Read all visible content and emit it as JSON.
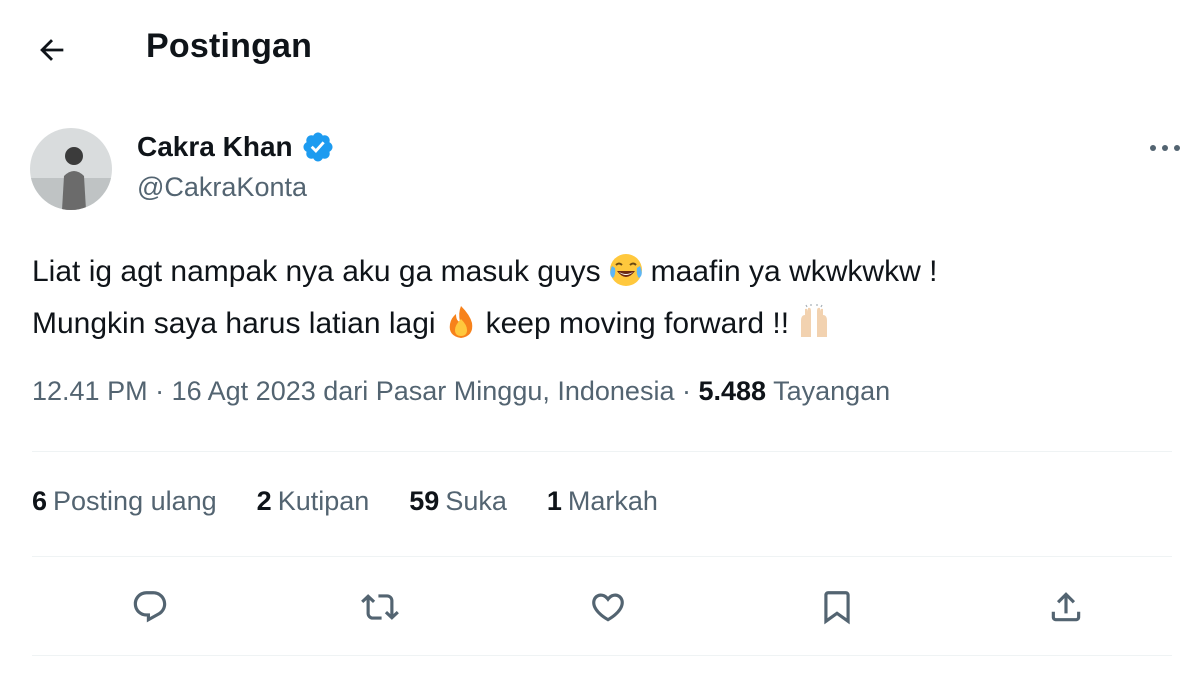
{
  "header": {
    "title": "Postingan",
    "back_icon": "arrow-left-icon"
  },
  "author": {
    "display_name": "Cakra Khan",
    "handle": "@CakraKonta",
    "verified_color": "#1d9bf0",
    "avatar_icon": "profile-photo"
  },
  "tweet": {
    "line1_part1": "Liat ig agt nampak nya aku ga masuk guys",
    "line1_part2": "maafin ya  wkwkwkw !",
    "line2_part1": "Mungkin saya harus latian lagi",
    "line2_part2": "keep moving forward !!",
    "emojis": [
      "face-with-tears-of-joy",
      "fire",
      "raising-hands"
    ]
  },
  "meta": {
    "time": "12.41 PM",
    "separator": "·",
    "date_location": "16 Agt 2023 dari Pasar Minggu, Indonesia",
    "views_count": "5.488",
    "views_label": "Tayangan"
  },
  "stats": {
    "reposts_count": "6",
    "reposts_label": "Posting ulang",
    "quotes_count": "2",
    "quotes_label": "Kutipan",
    "likes_count": "59",
    "likes_label": "Suka",
    "bookmarks_count": "1",
    "bookmarks_label": "Markah"
  },
  "actions": [
    "reply-icon",
    "repost-icon",
    "like-icon",
    "bookmark-icon",
    "share-icon"
  ],
  "colors": {
    "text": "#0f1419",
    "secondary": "#536471",
    "accent": "#1d9bf0",
    "divider": "#eff3f4"
  }
}
